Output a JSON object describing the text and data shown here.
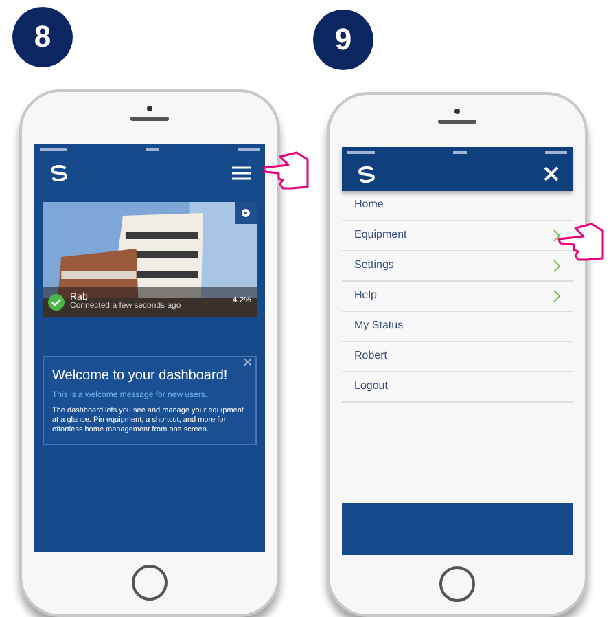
{
  "steps": [
    {
      "number": "8"
    },
    {
      "number": "9"
    }
  ],
  "dashboard": {
    "card": {
      "name": "Rab",
      "status": "Connected a few seconds ago",
      "reading": "4.2%"
    },
    "welcome": {
      "title": "Welcome to your dashboard!",
      "subtitle": "This is a welcome message for new users.",
      "body": "The dashboard lets you see and manage your equipment at a glance. Pin equipment, a shortcut, and more for effortless home management from one screen."
    }
  },
  "menu": {
    "items": [
      {
        "label": "Home",
        "has_submenu": false
      },
      {
        "label": "Equipment",
        "has_submenu": true
      },
      {
        "label": "Settings",
        "has_submenu": true
      },
      {
        "label": "Help",
        "has_submenu": true
      },
      {
        "label": "My Status",
        "has_submenu": false
      },
      {
        "label": "Robert",
        "has_submenu": false
      },
      {
        "label": "Logout",
        "has_submenu": false
      }
    ]
  }
}
